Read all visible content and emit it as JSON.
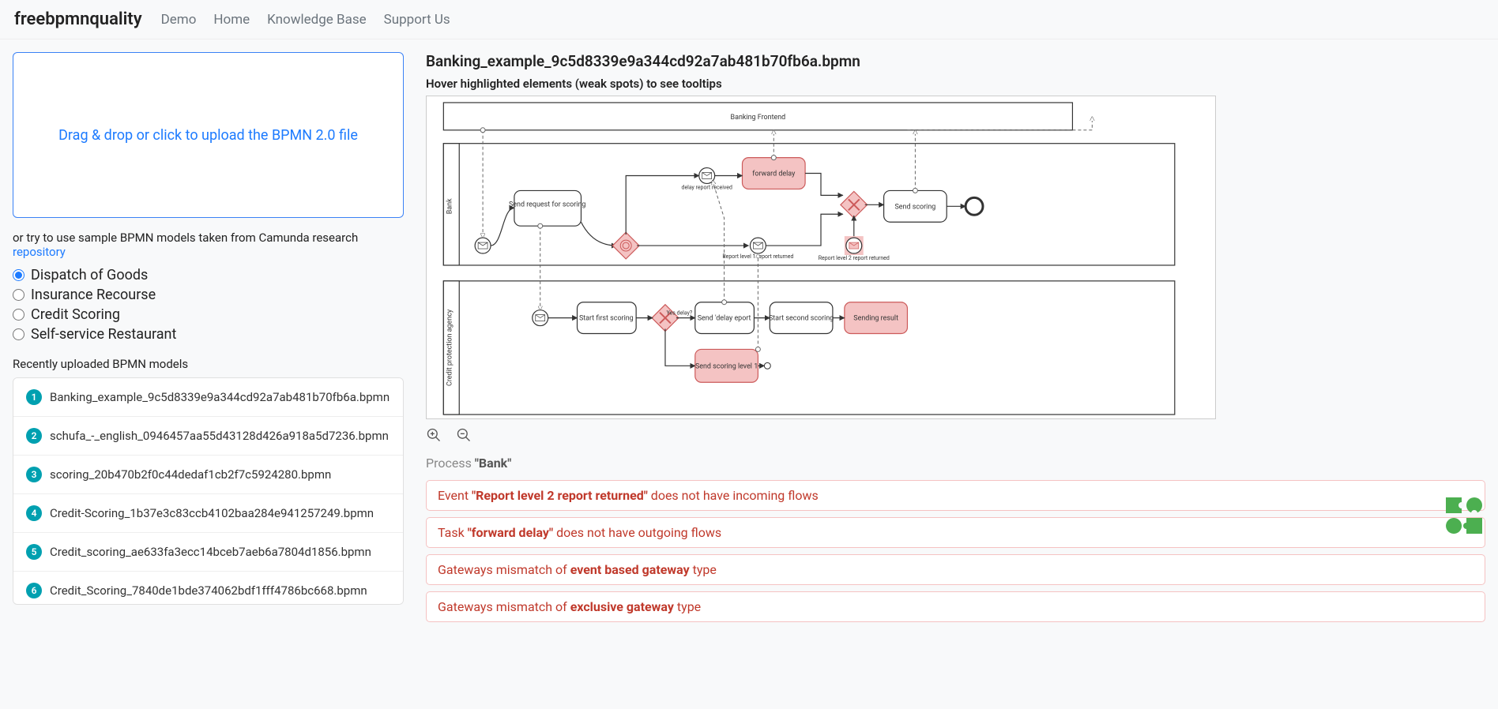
{
  "nav": {
    "brand": "freebpmnquality",
    "links": [
      "Demo",
      "Home",
      "Knowledge Base",
      "Support Us"
    ]
  },
  "dropzone": {
    "text": "Drag & drop or click to upload the BPMN 2.0 file"
  },
  "sample": {
    "prefix": "or try to use sample BPMN models taken from Camunda research ",
    "link_text": "repository"
  },
  "samples": [
    {
      "label": "Dispatch of Goods",
      "checked": true
    },
    {
      "label": "Insurance Recourse",
      "checked": false
    },
    {
      "label": "Credit Scoring",
      "checked": false
    },
    {
      "label": "Self-service Restaurant",
      "checked": false
    }
  ],
  "recent_header": "Recently uploaded BPMN models",
  "recent": [
    "Banking_example_9c5d8339e9a344cd92a7ab481b70fb6a.bpmn",
    "schufa_-_english_0946457aa55d43128d426a918a5d7236.bpmn",
    "scoring_20b470b2f0c44dedaf1cb2f7c5924280.bpmn",
    "Credit-Scoring_1b37e3c83ccb4102baa284e941257249.bpmn",
    "Credit_scoring_ae633fa3ecc14bceb7aeb6a7804d1856.bpmn",
    "Credit_Scoring_7840de1bde374062bdf1fff4786bc668.bpmn"
  ],
  "file_title": "Banking_example_9c5d8339e9a344cd92a7ab481b70fb6a.bpmn",
  "hover_hint": "Hover highlighted elements (weak spots) to see tooltips",
  "diagram": {
    "pool1": "Banking Frontend",
    "lane_bank": "Bank",
    "lane_cpa": "Credit protection agency",
    "task_srs": "Send request for scoring",
    "task_fwd": "forward delay",
    "task_sendscoring": "Send scoring",
    "evt_delay_recv": "delay report received",
    "evt_rl1": "Report level 1 report returned",
    "evt_rl2": "Report level 2 report returned",
    "task_sfs": "Start first scoring",
    "task_sdr": "Send 'delay eport",
    "task_sss": "Start second scoring",
    "task_sres": "Sending result",
    "task_ssl1": "Send scoring level 1",
    "gw_delay_label": "Yes delay?"
  },
  "process_label_prefix": "Process ",
  "process_name": "\"Bank\"",
  "alerts": [
    {
      "pre": "Event ",
      "bold": "\"Report level 2 report returned\"",
      "post": " does not have incoming flows"
    },
    {
      "pre": "Task ",
      "bold": "\"forward delay\"",
      "post": " does not have outgoing flows"
    },
    {
      "pre": "Gateways mismatch of ",
      "bold": "event based gateway",
      "post": " type"
    },
    {
      "pre": "Gateways mismatch of ",
      "bold": "exclusive gateway",
      "post": " type"
    }
  ]
}
